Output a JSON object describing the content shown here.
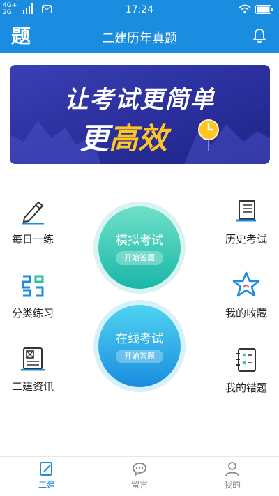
{
  "status": {
    "network_top": "4G+",
    "network_bottom": "2G",
    "time": "17:24"
  },
  "appbar": {
    "logo": "题",
    "title": "二建历年真题"
  },
  "banner": {
    "line1": "让考试更简单",
    "line2_a": "更",
    "line2_b": "高效"
  },
  "left_items": [
    {
      "label": "每日一练",
      "icon": "pencil-icon"
    },
    {
      "label": "分类练习",
      "icon": "category-icon"
    },
    {
      "label": "二建资讯",
      "icon": "news-book-icon"
    }
  ],
  "right_items": [
    {
      "label": "历史考试",
      "icon": "scroll-icon"
    },
    {
      "label": "我的收藏",
      "icon": "star-icon"
    },
    {
      "label": "我的错题",
      "icon": "wrong-notebook-icon"
    }
  ],
  "circles": [
    {
      "title": "模拟考试",
      "button": "开始答题",
      "color_top": "#6fe0c8",
      "color_bottom": "#19b7a8"
    },
    {
      "title": "在线考试",
      "button": "开始答题",
      "color_top": "#4fd3f0",
      "color_bottom": "#1a8de0"
    }
  ],
  "tabs": [
    {
      "label": "二建",
      "active": true
    },
    {
      "label": "留言",
      "active": false
    },
    {
      "label": "我的",
      "active": false
    }
  ],
  "colors": {
    "primary": "#1a8de0",
    "banner": "#2a2f9c",
    "highlight": "#ffc524"
  }
}
